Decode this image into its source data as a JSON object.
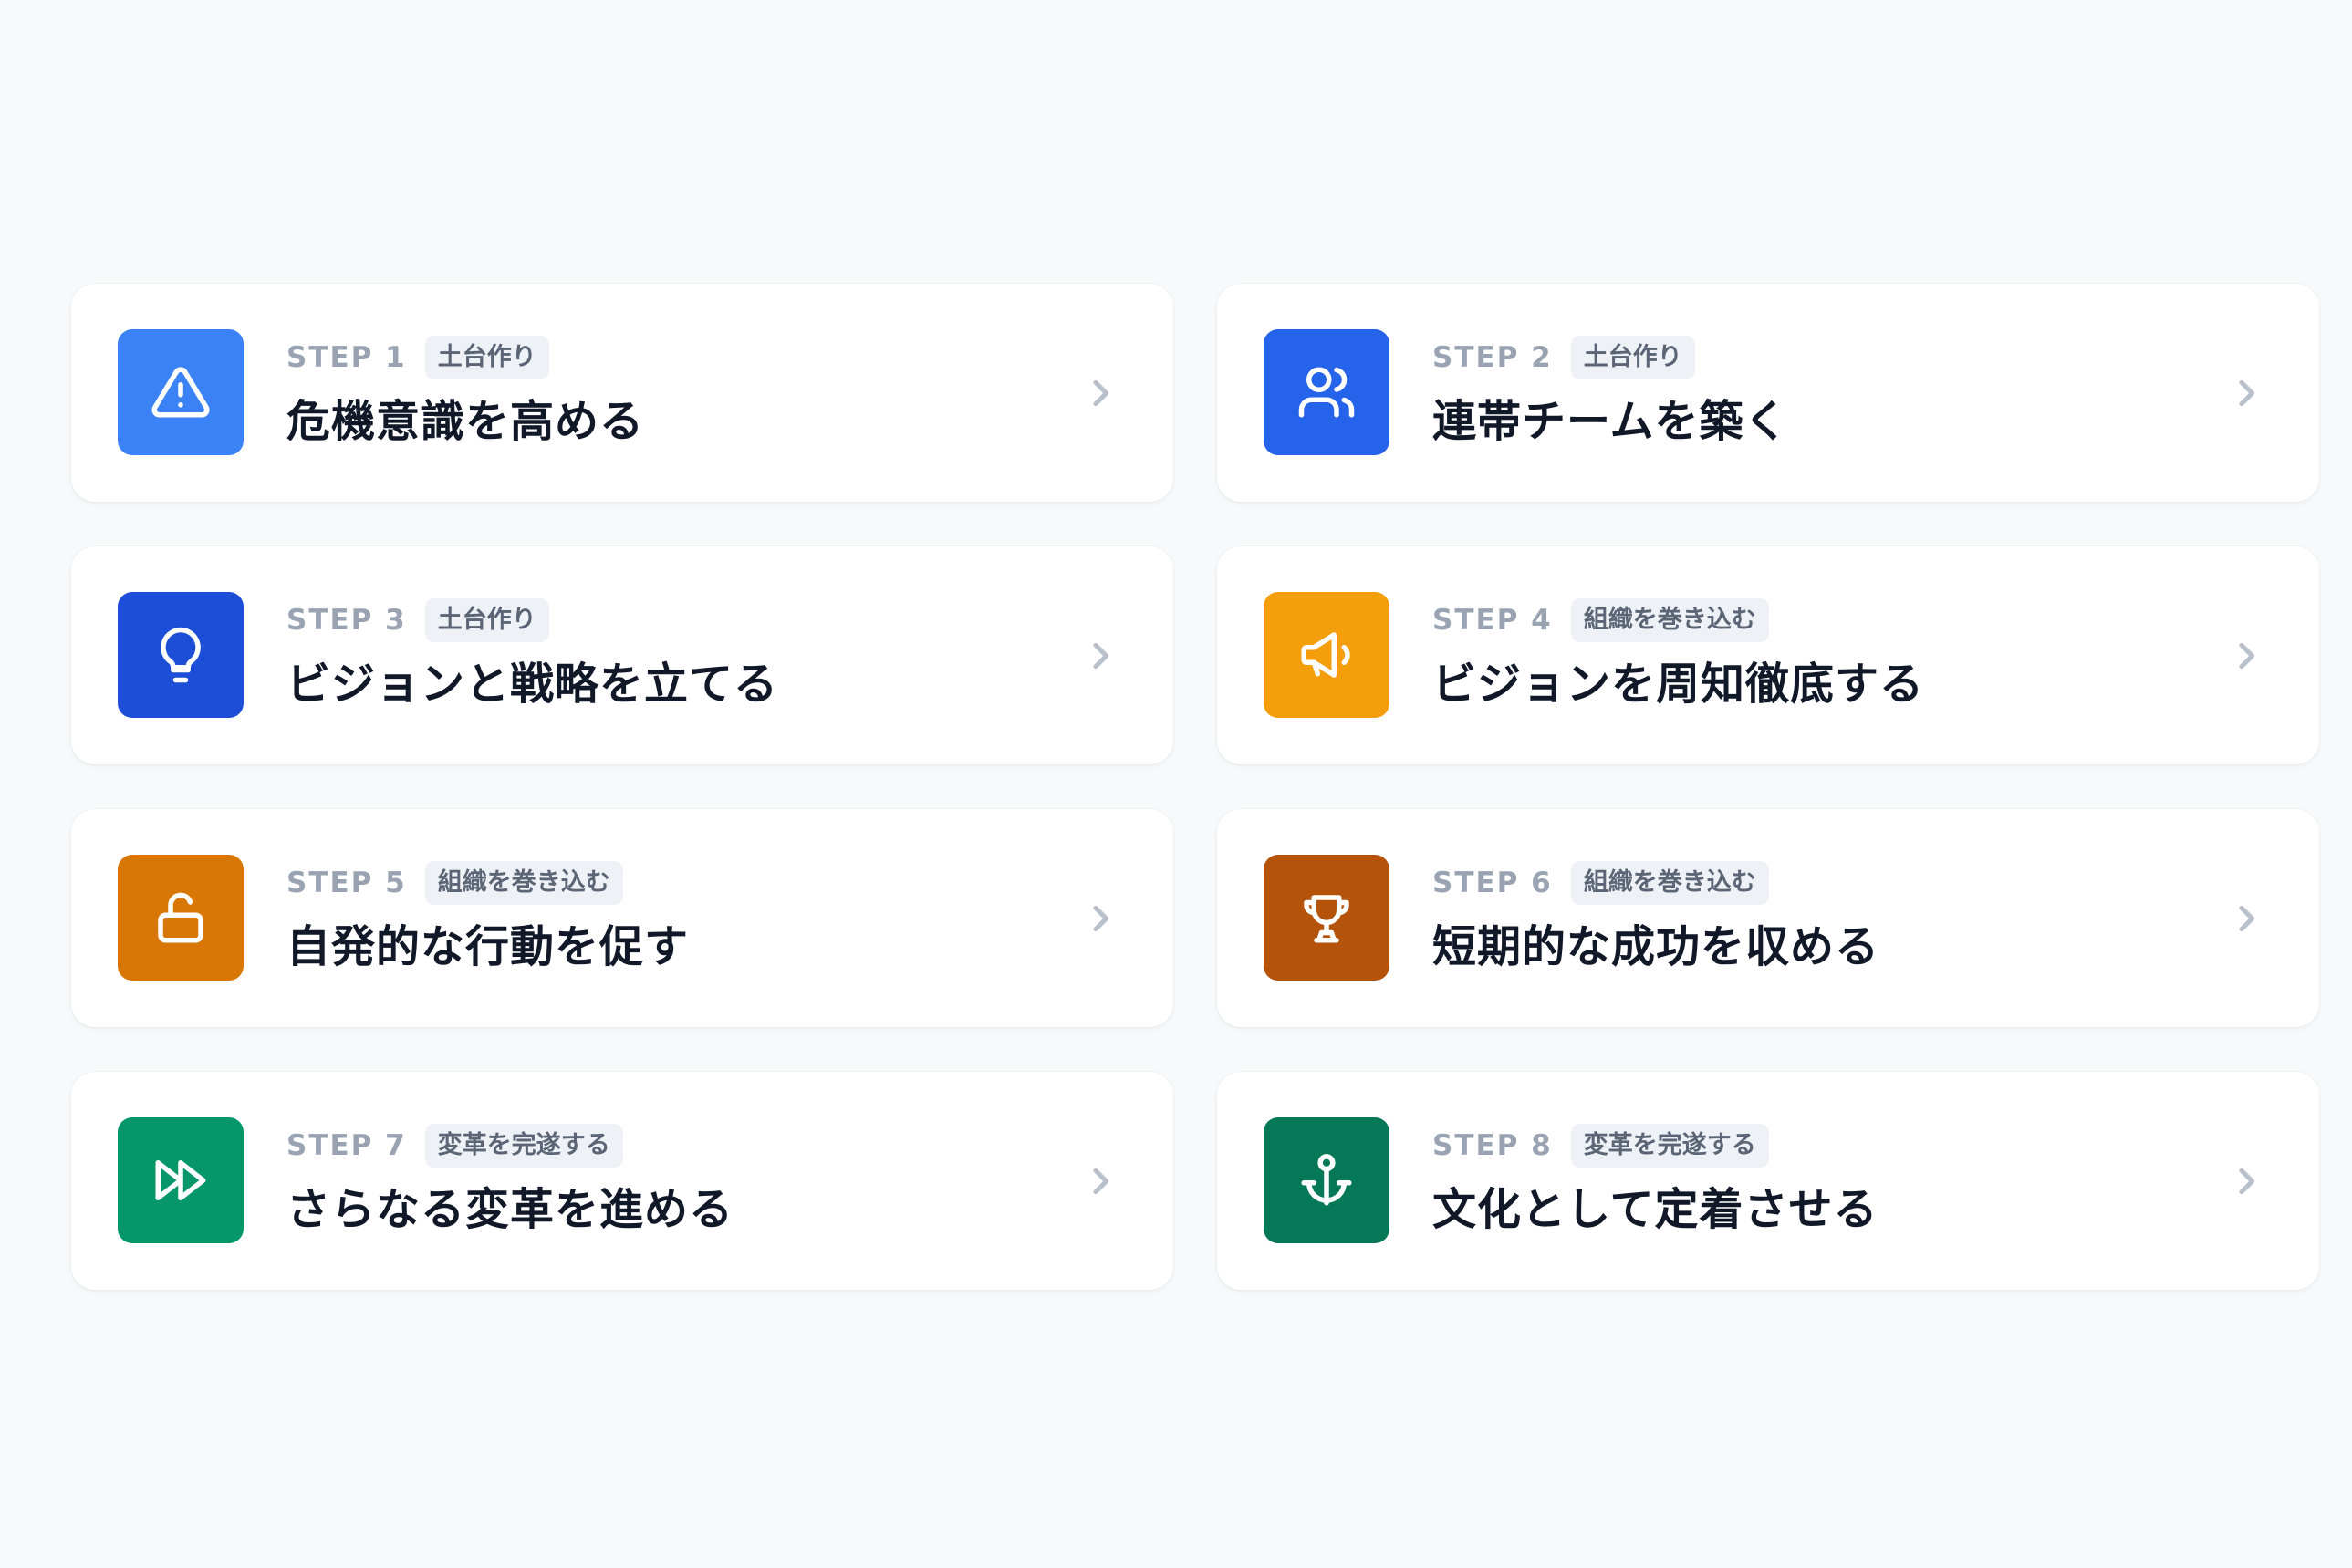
{
  "steps": [
    {
      "step_label": "STEP 1",
      "phase": "土台作り",
      "title": "危機意識を高める",
      "icon": "warning-triangle-icon",
      "color": "#3b82f6"
    },
    {
      "step_label": "STEP 2",
      "phase": "土台作り",
      "title": "連帯チームを築く",
      "icon": "users-icon",
      "color": "#2563eb"
    },
    {
      "step_label": "STEP 3",
      "phase": "土台作り",
      "title": "ビジョンと戦略を立てる",
      "icon": "lightbulb-icon",
      "color": "#1d4ed8"
    },
    {
      "step_label": "STEP 4",
      "phase": "組織を巻き込む",
      "title": "ビジョンを周知徹底する",
      "icon": "megaphone-icon",
      "color": "#f59e0b"
    },
    {
      "step_label": "STEP 5",
      "phase": "組織を巻き込む",
      "title": "自発的な行動を促す",
      "icon": "unlock-icon",
      "color": "#d97706"
    },
    {
      "step_label": "STEP 6",
      "phase": "組織を巻き込む",
      "title": "短期的な成功を収める",
      "icon": "trophy-icon",
      "color": "#b45309"
    },
    {
      "step_label": "STEP 7",
      "phase": "変革を完遂する",
      "title": "さらなる変革を進める",
      "icon": "fast-forward-icon",
      "color": "#059669"
    },
    {
      "step_label": "STEP 8",
      "phase": "変革を完遂する",
      "title": "文化として定着させる",
      "icon": "anchor-icon",
      "color": "#047857"
    }
  ]
}
